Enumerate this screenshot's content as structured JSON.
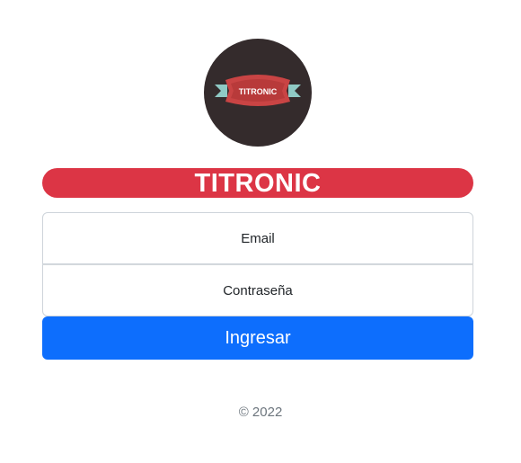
{
  "logo": {
    "text": "TITRONIC",
    "colors": {
      "background": "#342b2c",
      "banner": "#c94444",
      "ribbon": "#8fc9c4"
    }
  },
  "brand": {
    "title": "TITRONIC",
    "color": "#dc3545"
  },
  "login": {
    "email_placeholder": "Email",
    "password_placeholder": "Contraseña",
    "submit_label": "Ingresar",
    "submit_color": "#0d6efd"
  },
  "footer": {
    "copyright": "© 2022"
  }
}
